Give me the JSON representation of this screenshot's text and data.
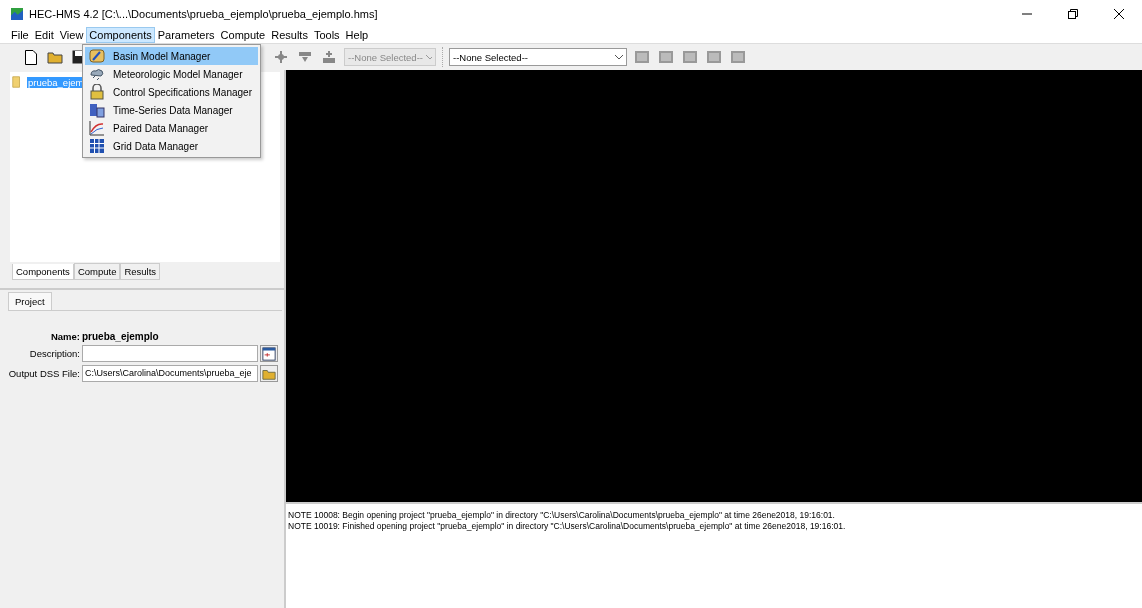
{
  "window": {
    "title": "HEC-HMS 4.2 [C:\\...\\Documents\\prueba_ejemplo\\prueba_ejemplo.hms]"
  },
  "menu_bar": [
    {
      "label": "File",
      "selected": false
    },
    {
      "label": "Edit",
      "selected": false
    },
    {
      "label": "View",
      "selected": false
    },
    {
      "label": "Components",
      "selected": true
    },
    {
      "label": "Parameters",
      "selected": false
    },
    {
      "label": "Compute",
      "selected": false
    },
    {
      "label": "Results",
      "selected": false
    },
    {
      "label": "Tools",
      "selected": false
    },
    {
      "label": "Help",
      "selected": false
    }
  ],
  "dropdown_menu": [
    {
      "label": "Basin Model Manager",
      "selected": true
    },
    {
      "label": "Meteorologic Model Manager",
      "selected": false
    },
    {
      "label": "Control Specifications Manager",
      "selected": false
    },
    {
      "label": "Time-Series Data Manager",
      "selected": false
    },
    {
      "label": "Paired Data Manager",
      "selected": false
    },
    {
      "label": "Grid Data Manager",
      "selected": false
    }
  ],
  "toolbar": {
    "run_select": {
      "value": "--None Selected--",
      "disabled": true
    },
    "model_select": {
      "value": "--None Selected--",
      "disabled": false
    }
  },
  "tree": [
    {
      "label": "prueba_ejem",
      "selected": true
    }
  ],
  "explorer_tabs": [
    {
      "label": "Components",
      "selected": true
    },
    {
      "label": "Compute",
      "selected": false
    },
    {
      "label": "Results",
      "selected": false
    }
  ],
  "editor": {
    "tab": "Project",
    "name_label": "Name:",
    "name_value": "prueba_ejemplo",
    "fields": [
      {
        "label": "Description:"
      },
      {
        "label": "Output DSS File:",
        "value": "C:\\Users\\Carolina\\Documents\\prueba_eje"
      }
    ]
  },
  "messages": [
    "NOTE 10008:  Begin opening project \"prueba_ejemplo\" in directory \"C:\\Users\\Carolina\\Documents\\prueba_ejemplo\" at time 26ene2018, 19:16:01.",
    "NOTE 10019:  Finished opening project \"prueba_ejemplo\" in directory \"C:\\Users\\Carolina\\Documents\\prueba_ejemplo\" at time 26ene2018, 19:16:01."
  ]
}
